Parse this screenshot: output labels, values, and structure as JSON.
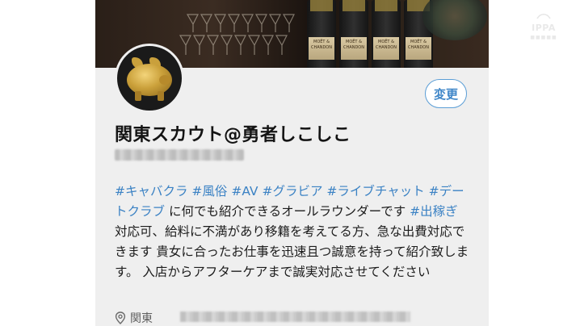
{
  "profile": {
    "display_name": "関東スカウト@勇者しこしこ",
    "edit_button_label": "変更",
    "location": "関東",
    "bio": {
      "hashtags_line1": "#キャバクラ #風俗 #AV #グラビア #ライブチャット #デートクラブ",
      "text1": " に何でも紹介できるオールラウンダーです ",
      "hashtag2": "#出稼ぎ",
      "text2": " 対応可、給料に不満があり移籍を考えてる方、急な出費対応できます 貴女に合ったお仕事を迅速且つ誠意を持って紹介致します。 入店からアフターケアまで誠実対応させてください"
    }
  },
  "watermark": {
    "mark": "IPPA"
  },
  "header_bottle_label": "MOËT & CHANDON",
  "colors": {
    "hashtag": "#3b82c4",
    "button_border": "#5b9ed6",
    "card_bg": "#efefef"
  },
  "icons": [
    "location-pin-icon",
    "avatar-gold-pig"
  ]
}
